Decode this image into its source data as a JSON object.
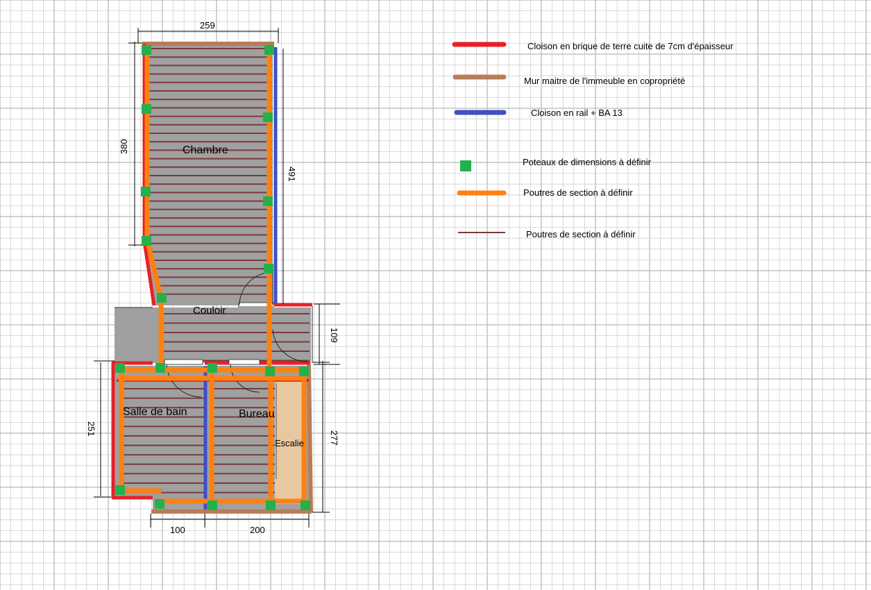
{
  "rooms": {
    "chambre": "Chambre",
    "couloir": "Couloir",
    "salle_de_bain": "Salle de bain",
    "bureau": "Bureau",
    "escalier": "Escalie"
  },
  "dimensions": {
    "top_width": "259",
    "left_height": "380",
    "right_height": "491",
    "corridor_height": "109",
    "bath_height": "251",
    "bottom_right_height": "277",
    "bottom_left_width": "100",
    "bottom_right_width": "200"
  },
  "legend": [
    {
      "label": "Cloison en brique de terre cuite de 7cm d'épaisseur",
      "color": "#e8202a",
      "kind": "thick-line",
      "icon": "red-line"
    },
    {
      "label": "Mur maitre de l'immeuble en copropriété",
      "color": "#b87c58",
      "kind": "thick-line",
      "icon": "brown-line"
    },
    {
      "label": "Cloison en rail + BA 13",
      "color": "#3f4fc4",
      "kind": "thick-line",
      "icon": "blue-line"
    },
    {
      "label": "Poteaux de dimensions à définir",
      "color": "#22b14c",
      "kind": "square",
      "icon": "green-square"
    },
    {
      "label": "Poutres de section à définir",
      "color": "#ff8010",
      "kind": "thick-line",
      "icon": "orange-line"
    },
    {
      "label": "Poutres de section à définir",
      "color": "#7a3a3a",
      "kind": "thin-line",
      "icon": "joist-line"
    }
  ],
  "colors": {
    "floor": "#a0a0a0",
    "joist": "#7a3a3a",
    "beam": "#ff8010",
    "post": "#22b14c",
    "brick": "#e8202a",
    "master_wall": "#b87c58",
    "rail_wall": "#3f4fc4",
    "stairs": "#e8c8a0",
    "grid": "#cfcfcf"
  }
}
